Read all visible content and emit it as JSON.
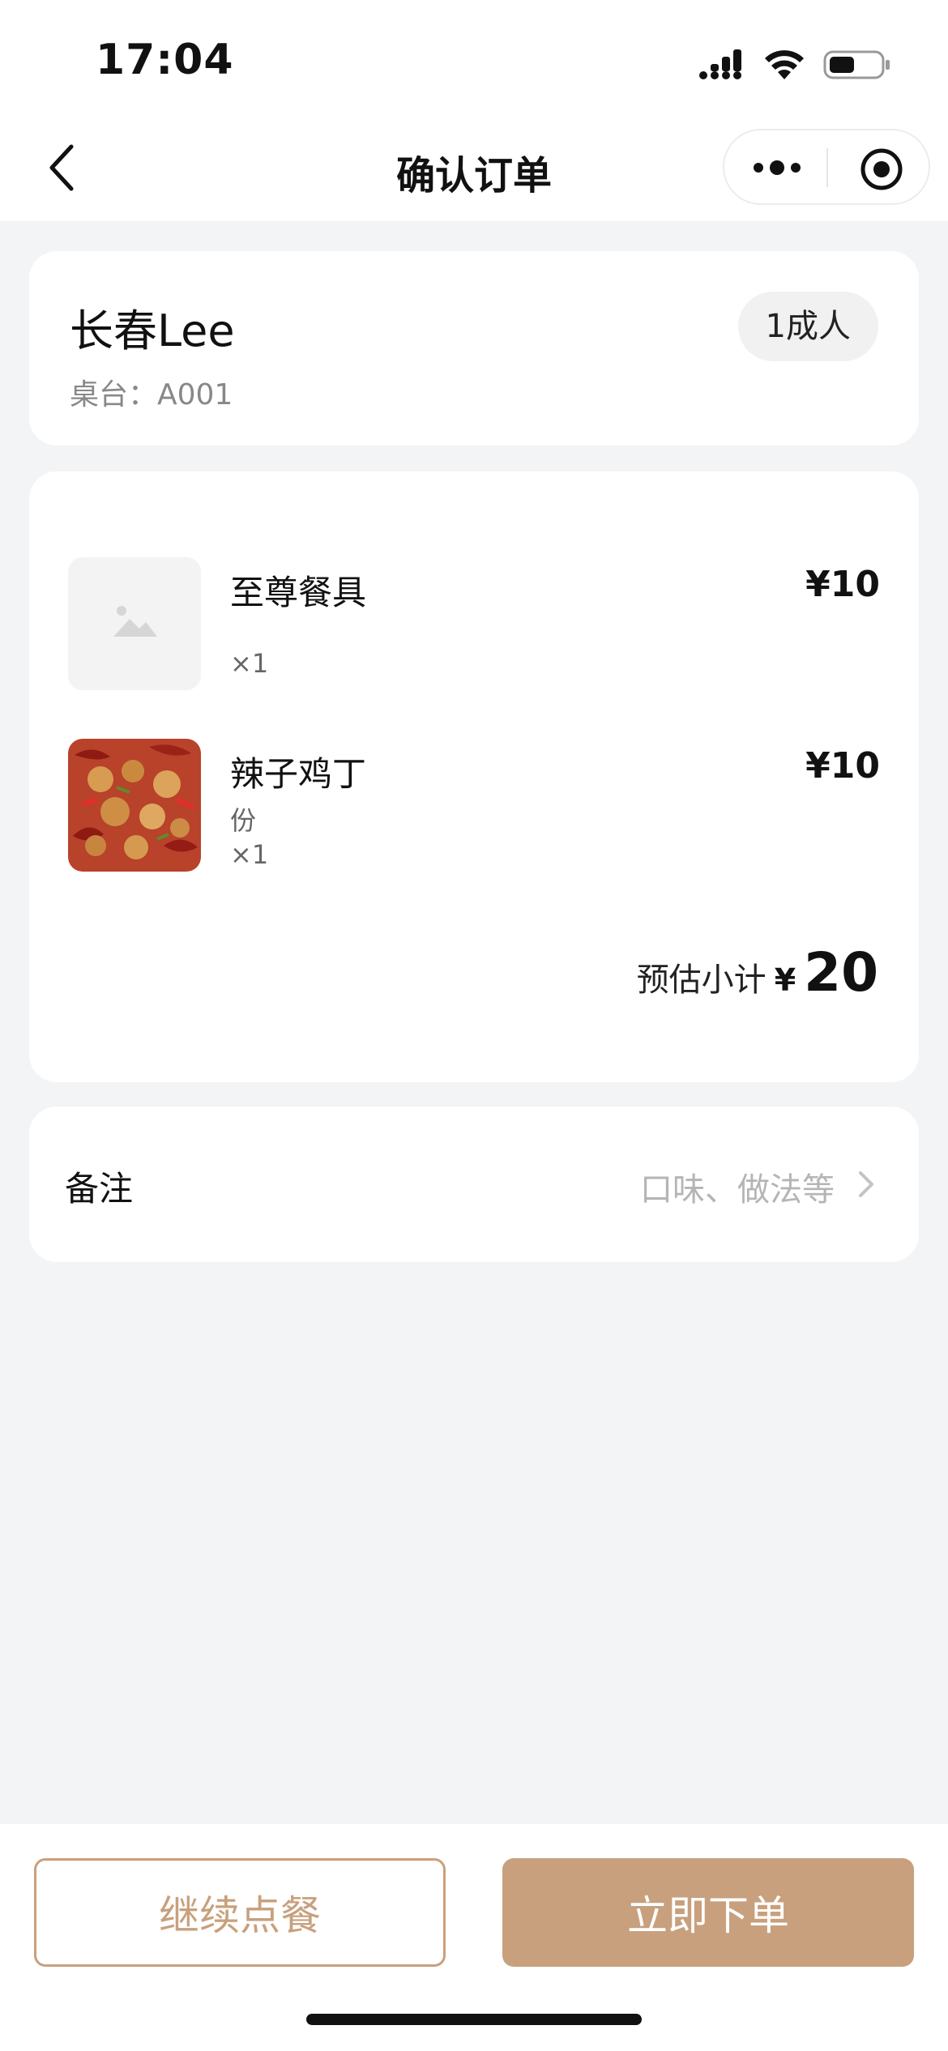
{
  "status": {
    "time": "17:04",
    "icons": [
      "cellular-signal-icon",
      "wifi-icon",
      "battery-icon"
    ]
  },
  "nav": {
    "title": "确认订单",
    "back_icon": "chevron-left-icon",
    "more_icon": "more-dots-icon",
    "target_icon": "target-icon"
  },
  "user": {
    "name": "长春Lee",
    "table": "桌台：A001",
    "people": "1成人"
  },
  "items": [
    {
      "name": "至尊餐具",
      "spec": "",
      "qty": "×1",
      "price": "¥10",
      "thumb": "image-placeholder-icon"
    },
    {
      "name": "辣子鸡丁",
      "spec": "份",
      "qty": "×1",
      "price": "¥10",
      "thumb": "dish-photo"
    }
  ],
  "subtotal": {
    "label": "预估小计",
    "currency": "¥",
    "value": "20"
  },
  "remark": {
    "label": "备注",
    "hint": "口味、做法等",
    "arrow_icon": "chevron-right-icon"
  },
  "actions": {
    "continue": "继续点餐",
    "order": "立即下单"
  },
  "colors": {
    "accent": "#c8a07d",
    "background": "#f3f4f6",
    "card": "#ffffff"
  }
}
